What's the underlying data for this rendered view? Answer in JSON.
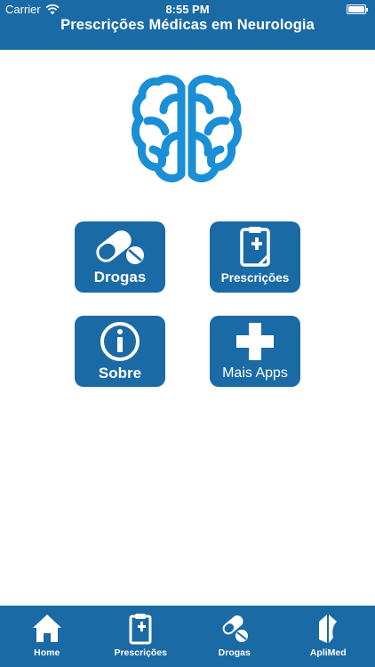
{
  "status_bar": {
    "carrier": "Carrier",
    "time": "8:55 PM"
  },
  "header": {
    "title": "Prescrições Médicas em Neurologia"
  },
  "logo": {
    "icon": "brain-icon",
    "color": "#1a8fd6"
  },
  "menu": {
    "drogas_label": "Drogas",
    "prescricoes_label": "Prescrições",
    "sobre_label": "Sobre",
    "mais_apps_label": "Mais Apps"
  },
  "tabbar": {
    "items": [
      {
        "label": "Home",
        "icon": "home-icon"
      },
      {
        "label": "Prescrições",
        "icon": "clipboard-plus-icon"
      },
      {
        "label": "Drogas",
        "icon": "pills-icon"
      },
      {
        "label": "ApliMed",
        "icon": "aplimed-logo-icon"
      }
    ]
  },
  "colors": {
    "primary": "#1a6aa6",
    "brain": "#1a8fd6",
    "background": "#ffffff"
  }
}
